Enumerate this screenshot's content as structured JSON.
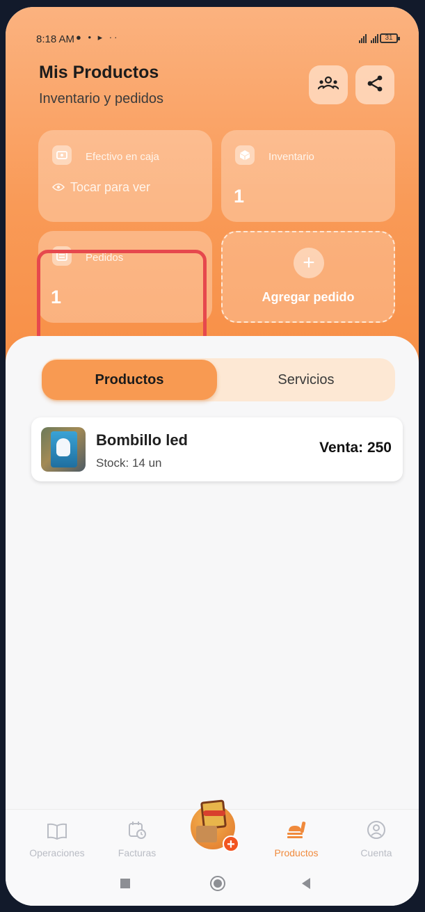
{
  "status_bar": {
    "time": "8:18 AM",
    "icons": "● • ▸ ··",
    "battery": "31"
  },
  "header": {
    "title": "Mis Productos",
    "subtitle": "Inventario y pedidos",
    "people_icon": "people-group-icon",
    "share_icon": "share-icon"
  },
  "stats": {
    "cash": {
      "label": "Efectivo en caja",
      "reveal_text": "Tocar para ver",
      "icon": "cash-icon"
    },
    "inventory": {
      "label": "Inventario",
      "value": "1",
      "icon": "box-icon"
    },
    "orders": {
      "label": "Pedidos",
      "value": "1",
      "icon": "list-icon"
    },
    "add_order": {
      "label": "Agregar pedido",
      "icon": "plus-icon"
    }
  },
  "tabs": {
    "active": "Productos",
    "inactive": "Servicios"
  },
  "products": [
    {
      "name": "Bombillo led",
      "stock": "Stock: 14 un",
      "price": "Venta: 250"
    }
  ],
  "bottom_nav": {
    "items": [
      {
        "label": "Operaciones",
        "icon": "book-icon"
      },
      {
        "label": "Facturas",
        "icon": "calendar-clock-icon"
      },
      {
        "label": "Productos",
        "icon": "food-stand-icon",
        "active": true
      },
      {
        "label": "Cuenta",
        "icon": "user-circle-icon"
      }
    ]
  },
  "colors": {
    "accent": "#f89a52",
    "highlight": "#e6484d",
    "active_nav": "#f08a3c"
  }
}
